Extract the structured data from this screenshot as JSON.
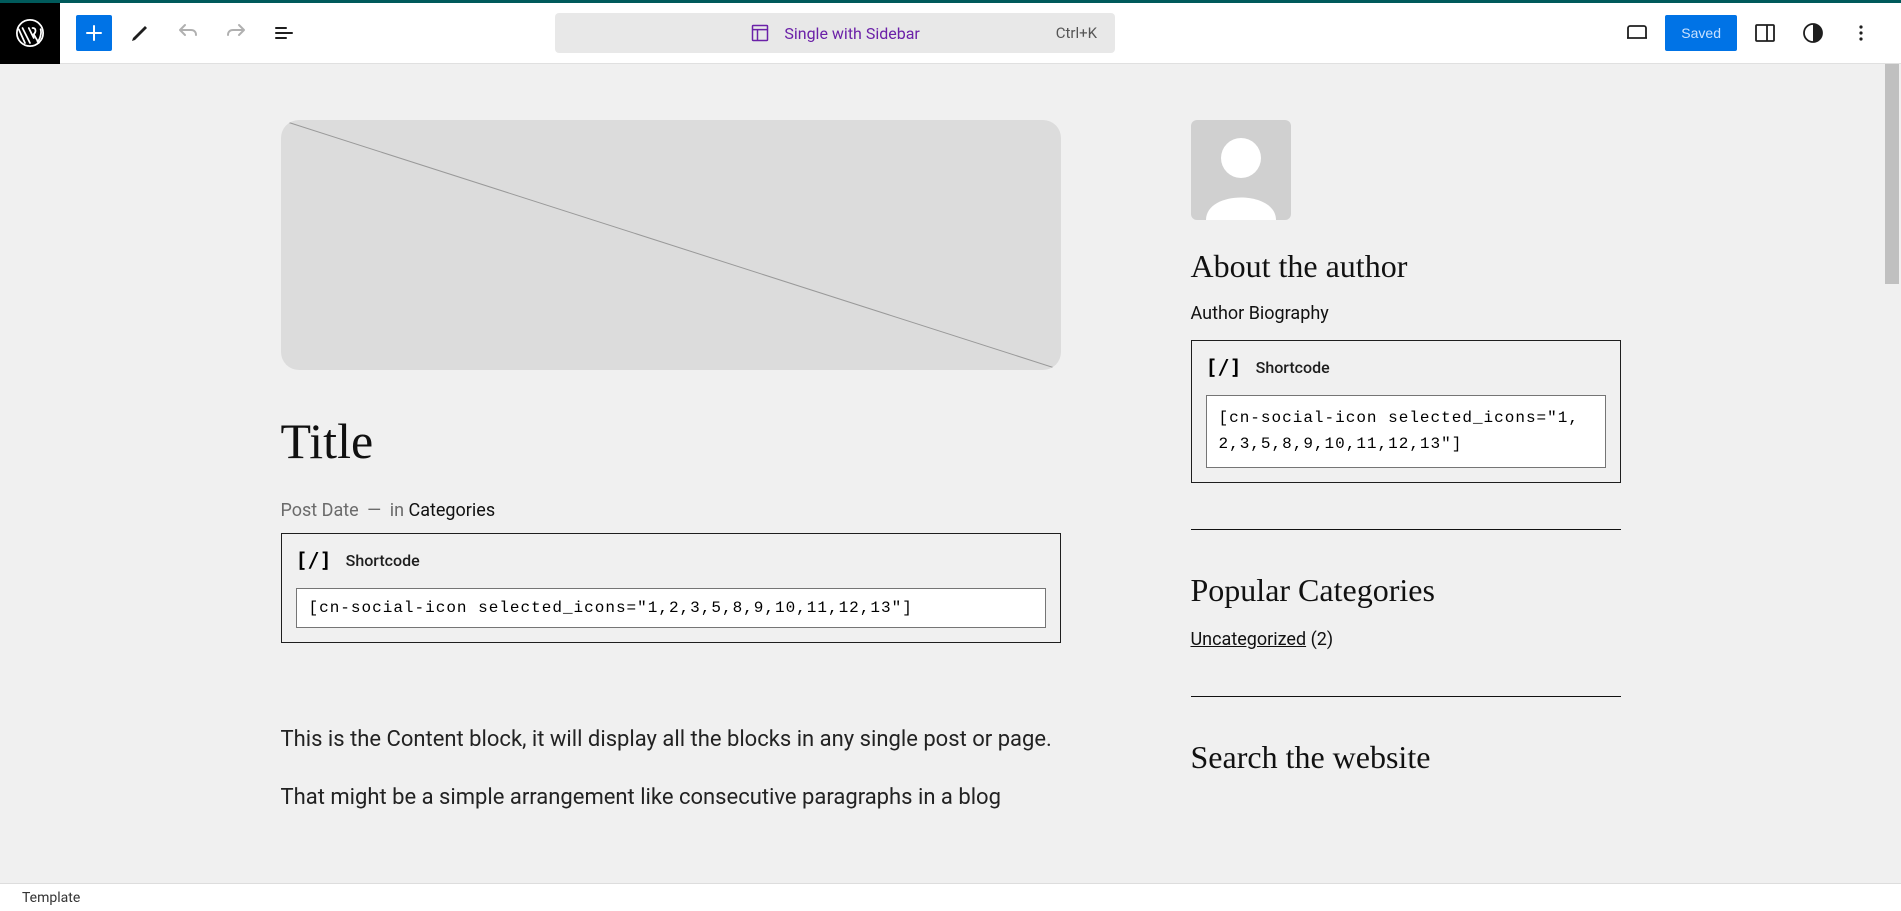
{
  "toolbar": {
    "template_name": "Single with Sidebar",
    "shortcut": "Ctrl+K",
    "saved_label": "Saved"
  },
  "main": {
    "title": "Title",
    "meta_date": "Post Date",
    "meta_in": "in",
    "meta_cats": "Categories",
    "shortcode_label": "Shortcode",
    "shortcode_value": "[cn-social-icon selected_icons=\"1,2,3,5,8,9,10,11,12,13\"]",
    "content_p1": "This is the Content block, it will display all the blocks in any single post or page.",
    "content_p2": "That might be a simple arrangement like consecutive paragraphs in a blog"
  },
  "sidebar": {
    "about_heading": "About the author",
    "about_bio": "Author Biography",
    "shortcode_label": "Shortcode",
    "shortcode_value": "[cn-social-icon selected_icons=\"1,2,3,5,8,9,10,11,12,13\"]",
    "popular_heading": "Popular Categories",
    "cat_name": "Uncategorized",
    "cat_count": "(2)",
    "search_heading": "Search the website"
  },
  "footer": {
    "breadcrumb": "Template"
  }
}
